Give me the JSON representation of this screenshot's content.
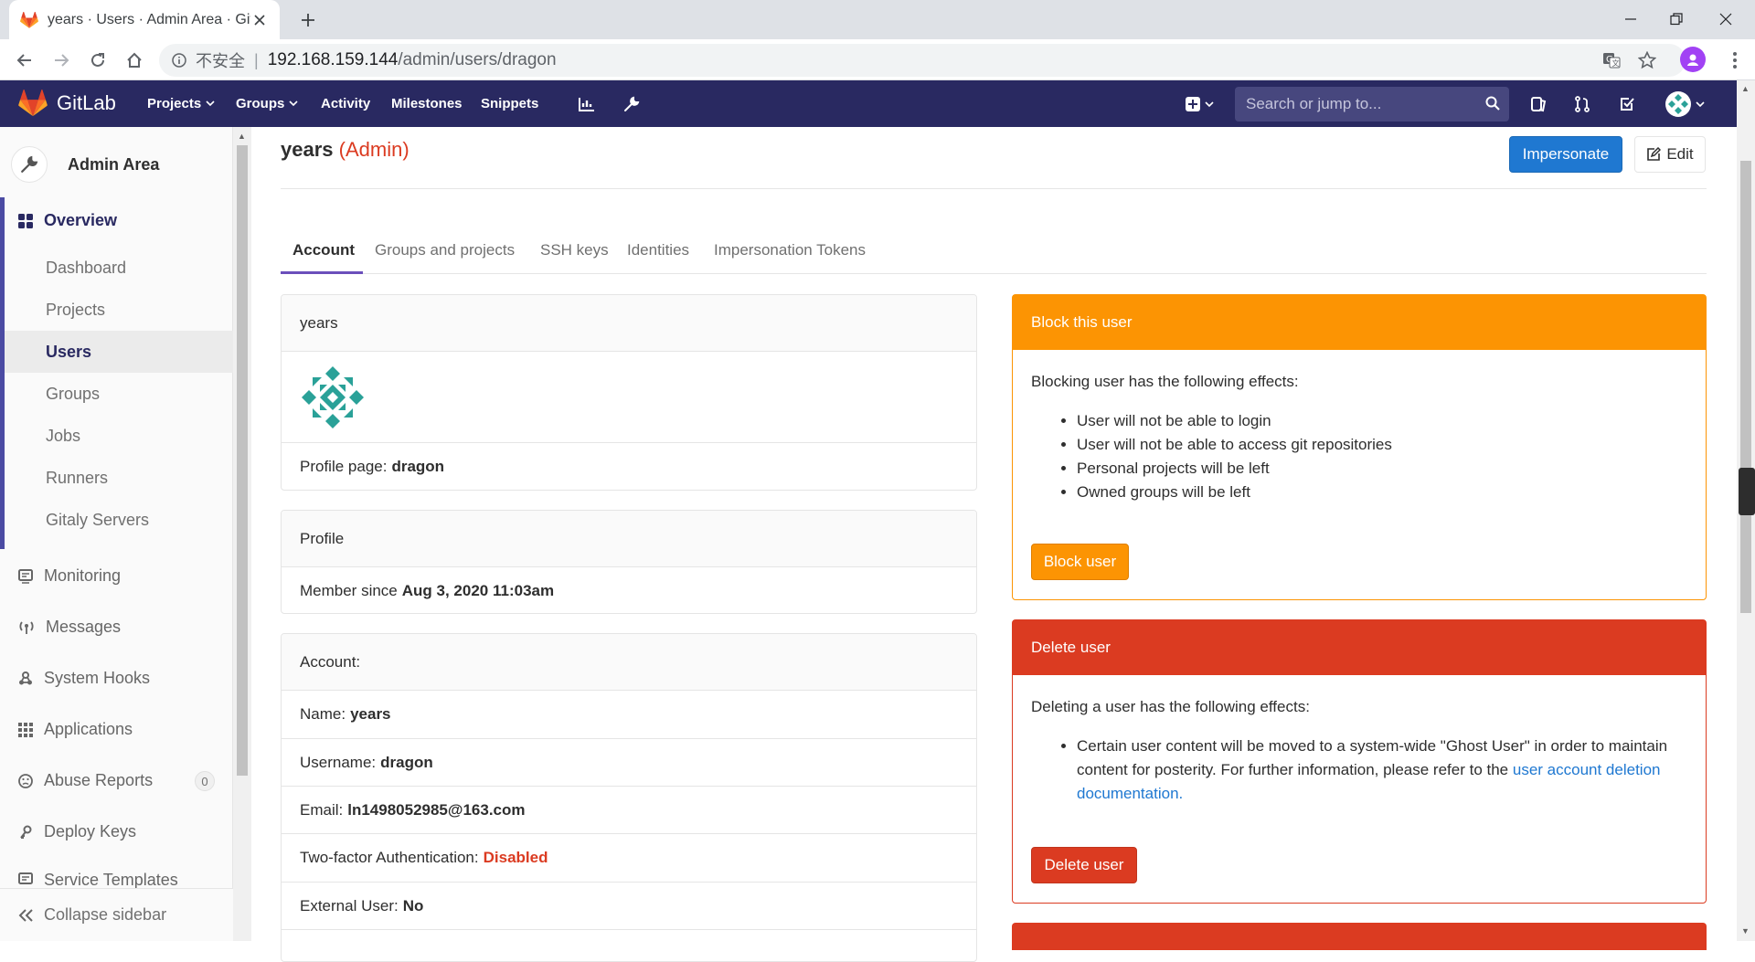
{
  "browser": {
    "tab_title": "years · Users · Admin Area · GitLab",
    "insecure_label": "不安全",
    "url_host": "192.168.159.144",
    "url_path": "/admin/users/dragon"
  },
  "header": {
    "logo_text": "GitLab",
    "nav": [
      "Projects",
      "Groups",
      "Activity",
      "Milestones",
      "Snippets"
    ],
    "search_placeholder": "Search or jump to..."
  },
  "sidebar": {
    "context_title": "Admin Area",
    "overview": "Overview",
    "sub_items": [
      "Dashboard",
      "Projects",
      "Users",
      "Groups",
      "Jobs",
      "Runners",
      "Gitaly Servers"
    ],
    "items": [
      "Monitoring",
      "Messages",
      "System Hooks",
      "Applications",
      "Abuse Reports",
      "Deploy Keys",
      "Service Templates"
    ],
    "abuse_count": "0",
    "collapse": "Collapse sidebar"
  },
  "main": {
    "user_name": "years",
    "admin_label": "(Admin)",
    "impersonate": "Impersonate",
    "edit": "Edit",
    "tabs": [
      "Account",
      "Groups and projects",
      "SSH keys",
      "Identities",
      "Impersonation Tokens"
    ],
    "card1": {
      "head": "years",
      "profile_label": "Profile page:",
      "profile_value": "dragon"
    },
    "card2": {
      "head": "Profile",
      "member_label": "Member since",
      "member_value": "Aug 3, 2020 11:03am"
    },
    "card3": {
      "head": "Account:",
      "name_label": "Name:",
      "name_value": "years",
      "username_label": "Username:",
      "username_value": "dragon",
      "email_label": "Email:",
      "email_value": "ln1498052985@163.com",
      "twofa_label": "Two-factor Authentication:",
      "twofa_value": "Disabled",
      "external_label": "External User:",
      "external_value": "No"
    },
    "block": {
      "head": "Block this user",
      "intro": "Blocking user has the following effects:",
      "effects": [
        "User will not be able to login",
        "User will not be able to access git repositories",
        "Personal projects will be left",
        "Owned groups will be left"
      ],
      "button": "Block user"
    },
    "delete": {
      "head": "Delete user",
      "intro": "Deleting a user has the following effects:",
      "effect_text_1": "Certain user content will be moved to a system-wide \"Ghost User\" in order to maintain content for posterity. For further information, please refer to the",
      "effect_link": "user account deletion documentation",
      "effect_text_2": ".",
      "button": "Delete user"
    }
  },
  "colors": {
    "header_bg": "#292961",
    "primary": "#1f78d1",
    "warning": "#fc9403",
    "danger": "#db3b21"
  }
}
